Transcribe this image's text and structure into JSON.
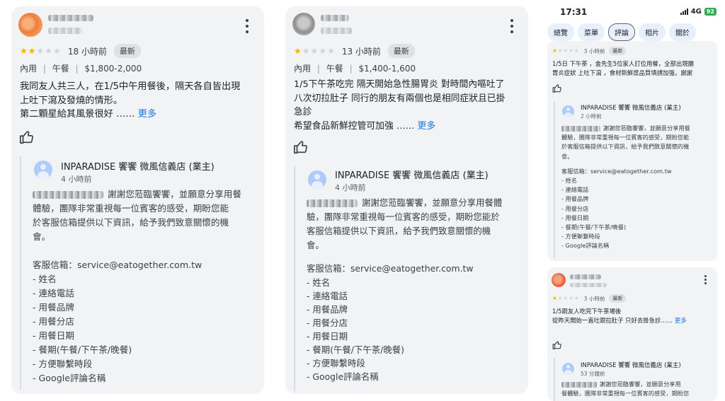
{
  "left_review": {
    "time": "18 小時前",
    "badge": "最新",
    "stars_filled": 2,
    "stars_total": 5,
    "meta": {
      "type": "內用",
      "meal": "午餐",
      "price": "$1,800-2,000",
      "sep": "|"
    },
    "text_lines": [
      "我同友人共三人，在1/5中午用餐後，隔天各自皆出現",
      "上吐下瀉及發燒的情形。",
      "第二顆星給其風景很好 ……"
    ],
    "more_label": "更多",
    "reply": {
      "owner": "INPARADISE 饗饗 微風信義店 (業主)",
      "time": "4 小時前",
      "lines": [
        "謝謝您蒞臨饗饗，並願意分享用餐",
        "體驗，團隊非常重視每一位賓客的感受，期盼您能",
        "於客服信箱提供以下資訊，給予我們致意關懷的機",
        "會。"
      ],
      "email_line": "客服信箱：service@eatogether.com.tw",
      "items": [
        "- 姓名",
        "- 連絡電話",
        "- 用餐品牌",
        "- 用餐分店",
        "- 用餐日期",
        "- 餐期(午餐/下午茶/晚餐)",
        "- 方便聯繫時段",
        "- Google評論名稱"
      ]
    }
  },
  "middle_review": {
    "time": "13 小時前",
    "badge": "最新",
    "stars_filled": 1,
    "stars_total": 5,
    "meta": {
      "type": "內用",
      "meal": "午餐",
      "price": "$1,400-1,600",
      "sep": "|"
    },
    "text_lines": [
      "1/5下午茶吃完 隔天開始急性腸胃炎 對時間內嘔吐了",
      "八次切拉肚子 同行的朋友有兩個也是相同症狀且已掛",
      "急診",
      "希望食品新鮮控管可加強 ……"
    ],
    "more_label": "更多",
    "reply": {
      "owner": "INPARADISE 饗饗 微風信義店 (業主)",
      "time": "4 小時前",
      "lines": [
        "謝謝您蒞臨饗饗，並願意分享用餐體",
        "驗，團隊非常重視每一位賓客的感受，期盼您能於",
        "客服信箱提供以下資訊，給予我們致意關懷的機",
        "會。"
      ],
      "email_line": "客服信箱：service@eatogether.com.tw",
      "items": [
        "- 姓名",
        "- 連絡電話",
        "- 用餐品牌",
        "- 用餐分店",
        "- 用餐日期",
        "- 餐期(午餐/下午茶/晚餐)",
        "- 方便聯繫時段",
        "- Google評論名稱"
      ]
    }
  },
  "phone": {
    "status": {
      "time": "17:31",
      "network": "4G",
      "battery": "92"
    },
    "tabs": [
      "總覽",
      "菜單",
      "評論",
      "相片",
      "關於"
    ],
    "active_tab": 2,
    "review1": {
      "time": "3 小時前",
      "badge": "最新",
      "stars_filled": 1,
      "text_lines": [
        "1/5日 下午茶 ，金先生5位家人訂位用餐，全部出現腸",
        "胃炎症狀 上吐下瀉 ，食材新鮮度品質填請加強，謝謝"
      ],
      "reply": {
        "owner": "INPARADISE 饗饗 微風信義店 (業主)",
        "time": "2 小時前",
        "lines": [
          "謝謝您蒞臨饗饗，並願意分享用餐",
          "體驗，團隊非常重視每一位賓客的感受，期盼您能",
          "於客服信箱提供以下資訊，給予我們致意關懷的機",
          "會。"
        ],
        "email_line": "客服信箱：service@eatogether.com.tw",
        "items": [
          "- 姓名",
          "- 連絡電話",
          "- 用餐品牌",
          "- 用餐分店",
          "- 用餐日期",
          "- 餐期(午餐/下午茶/晚餐)",
          "- 方便聯繫時段",
          "- Google評論名稱"
        ]
      }
    },
    "review2": {
      "time": "3 小時前",
      "badge": "最新",
      "stars_filled": 1,
      "text_lines": [
        "1/5跟友人吃完下午茶場後",
        "從昨天開始一直吐跟拉肚子 只好去掛急診…… "
      ],
      "more_label": "更多",
      "reply": {
        "owner": "INPARADISE 饗饗 微風信義店 (業主)",
        "time": "53 分鐘前",
        "lines": [
          "謝謝您蒞臨饗饗，並願意分享用",
          "餐體驗，團隊非常重視每一位賓客的感受，期盼您"
        ]
      }
    }
  },
  "colors": {
    "star_on": "#f4b400",
    "star_off": "#d1d4d7",
    "link": "#1a73e8",
    "card_bg": "#f1f3f4"
  },
  "icons": {
    "menu": "more-vert-icon",
    "like": "thumb-up-icon"
  }
}
